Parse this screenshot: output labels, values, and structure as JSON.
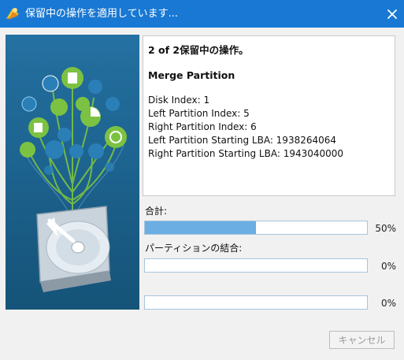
{
  "window": {
    "title": "保留中の操作を適用しています...",
    "close_glyph": "✕"
  },
  "info": {
    "heading": "2 of 2保留中の操作。",
    "operation": "Merge Partition",
    "details": [
      "Disk Index: 1",
      "Left Partition Index: 5",
      "Right Partition Index: 6",
      "Left Partition Starting LBA: 1938264064",
      "Right Partition Starting LBA: 1943040000"
    ]
  },
  "progress": {
    "total": {
      "label": "合計:",
      "value": 0.5,
      "percent_text": "50%"
    },
    "current": {
      "label": "パーティションの結合:",
      "value": 0,
      "percent_text": "0%"
    },
    "extra": {
      "value": 0,
      "percent_text": "0%"
    }
  },
  "buttons": {
    "cancel": "キャンセル"
  },
  "colors": {
    "titlebar": "#1878d3",
    "progress_fill": "#6aaee4",
    "art_background": "#1c5d89"
  },
  "icons": [
    "app-logo-icon",
    "close-icon",
    "hard-disk-icon",
    "tree-icons"
  ]
}
